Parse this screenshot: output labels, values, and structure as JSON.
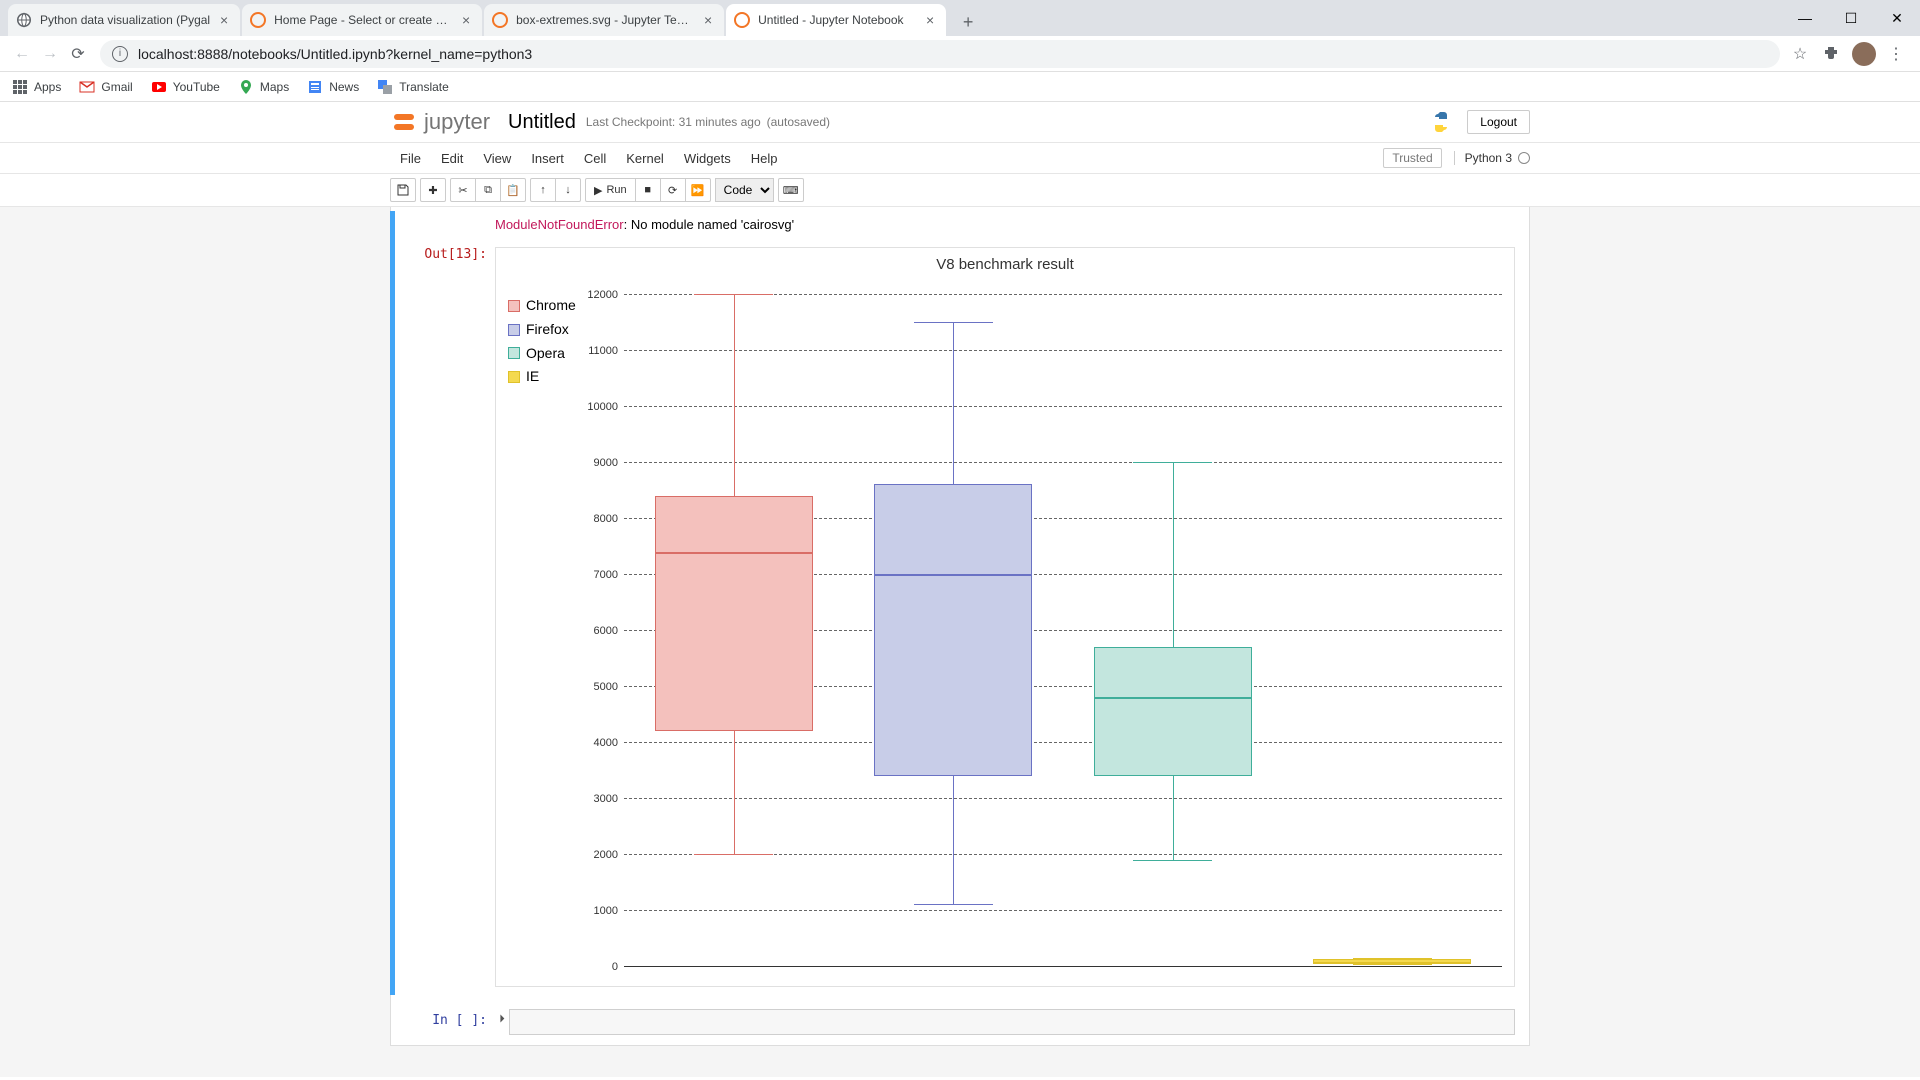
{
  "browser": {
    "tabs": [
      {
        "title": "Python data visualization (Pygal",
        "favicon": "globe"
      },
      {
        "title": "Home Page - Select or create a n",
        "favicon": "jupyter"
      },
      {
        "title": "box-extremes.svg - Jupyter Text E",
        "favicon": "jupyter"
      },
      {
        "title": "Untitled - Jupyter Notebook",
        "favicon": "jupyter",
        "active": true
      }
    ],
    "url": "localhost:8888/notebooks/Untitled.ipynb?kernel_name=python3",
    "bookmarks": [
      {
        "label": "Apps",
        "icon": "apps"
      },
      {
        "label": "Gmail",
        "icon": "gmail"
      },
      {
        "label": "YouTube",
        "icon": "youtube"
      },
      {
        "label": "Maps",
        "icon": "maps"
      },
      {
        "label": "News",
        "icon": "news"
      },
      {
        "label": "Translate",
        "icon": "translate"
      }
    ]
  },
  "jupyter": {
    "logo_text": "jupyter",
    "nb_title": "Untitled",
    "checkpoint": "Last Checkpoint: 31 minutes ago",
    "autosaved": "(autosaved)",
    "logout": "Logout",
    "trusted": "Trusted",
    "kernel": "Python 3",
    "menus": [
      "File",
      "Edit",
      "View",
      "Insert",
      "Cell",
      "Kernel",
      "Widgets",
      "Help"
    ],
    "run_label": "Run",
    "cell_type": "Code"
  },
  "error": {
    "name": "ModuleNotFoundError",
    "msg": ": No module named 'cairosvg'"
  },
  "out_prompt": "Out[13]:",
  "in_prompt": "In [ ]:",
  "colors": {
    "chrome_fill": "#f4c1bd",
    "chrome_stroke": "#d96d66",
    "firefox_fill": "#c8cde8",
    "firefox_stroke": "#6a72c4",
    "opera_fill": "#c3e6de",
    "opera_stroke": "#3fae9a",
    "ie_fill": "#f4d94f",
    "ie_stroke": "#e0c22a"
  },
  "chart_data": {
    "type": "box",
    "title": "V8 benchmark result",
    "ylabel": "",
    "ylim": [
      0,
      12000
    ],
    "yticks": [
      0,
      1000,
      2000,
      3000,
      4000,
      5000,
      6000,
      7000,
      8000,
      9000,
      10000,
      11000,
      12000
    ],
    "series": [
      {
        "name": "Chrome",
        "min": 2000,
        "q1": 4200,
        "median": 7400,
        "q3": 8400,
        "max": 12000
      },
      {
        "name": "Firefox",
        "min": 1100,
        "q1": 3400,
        "median": 7000,
        "q3": 8600,
        "max": 11500
      },
      {
        "name": "Opera",
        "min": 1900,
        "q1": 3400,
        "median": 4800,
        "q3": 5700,
        "max": 9000
      },
      {
        "name": "IE",
        "min": 40,
        "q1": 50,
        "median": 70,
        "q3": 120,
        "max": 150
      }
    ]
  }
}
